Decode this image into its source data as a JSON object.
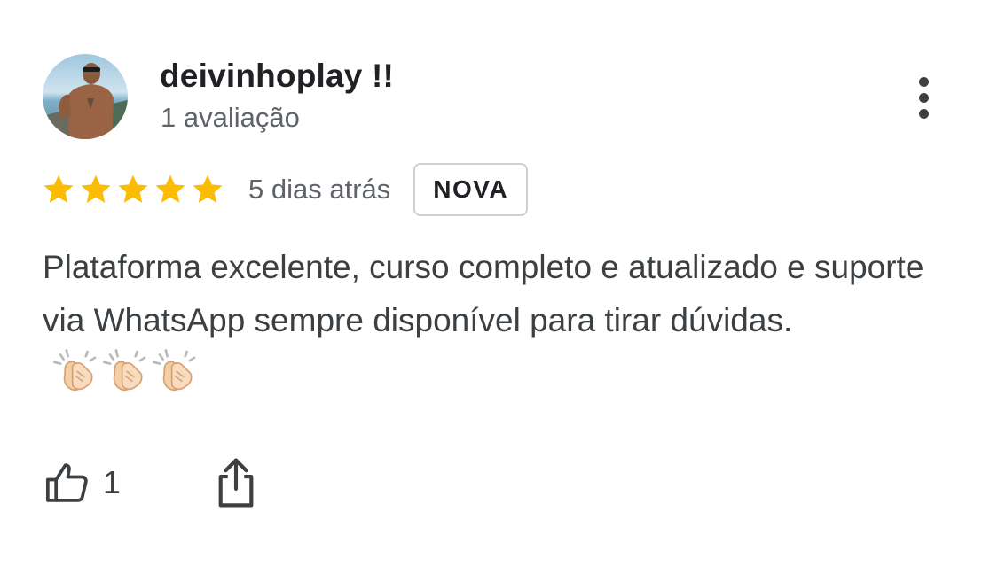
{
  "review": {
    "user_name": "deivinhoplay !!",
    "review_count": "1 avaliação",
    "rating": 5,
    "rating_max": 5,
    "date": "5 dias atrás",
    "badge": "NOVA",
    "text": "Plataforma excelente, curso completo e atualizado e suporte via WhatsApp sempre disponível para tirar dúvidas.",
    "emojis": [
      "clapping-hands",
      "clapping-hands",
      "clapping-hands"
    ],
    "like_count": "1"
  },
  "icons": {
    "more": "more-vert-icon",
    "like": "thumbs-up-icon",
    "share": "share-icon",
    "star": "star-icon"
  },
  "colors": {
    "star": "#FBBC04",
    "primary_text": "#202124",
    "secondary_text": "#5f6368",
    "badge_border": "#d0d0d0"
  }
}
